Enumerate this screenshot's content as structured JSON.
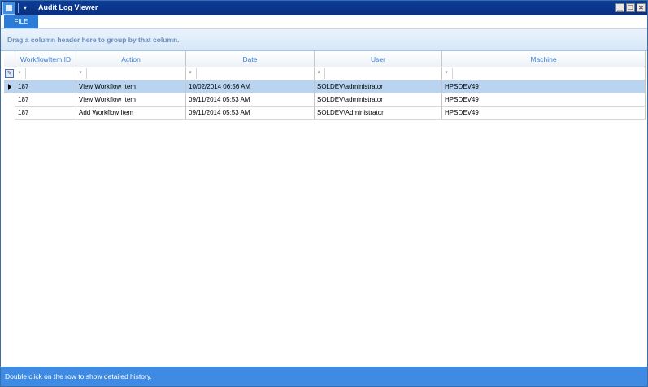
{
  "window": {
    "title": "Audit Log Viewer",
    "quick_access_glyph": "▾",
    "controls": {
      "minimize": "▁",
      "maximize": "☐",
      "close": "✕"
    }
  },
  "ribbon": {
    "file_tab": "FILE"
  },
  "grid": {
    "group_panel_text": "Drag a column header here to group by that column.",
    "columns": [
      "WorkflowItem ID",
      "Action",
      "Date",
      "User",
      "Machine"
    ],
    "filter_operator": "*",
    "rows": [
      [
        "187",
        "View Workflow Item",
        "10/02/2014 06:56 AM",
        "SOLDEV\\administrator",
        "HPSDEV49"
      ],
      [
        "187",
        "View Workflow Item",
        "09/11/2014 05:53 AM",
        "SOLDEV\\administrator",
        "HPSDEV49"
      ],
      [
        "187",
        "Add Workflow Item",
        "09/11/2014 05:53 AM",
        "SOLDEV\\Administrator",
        "HPSDEV49"
      ]
    ],
    "selected_row": 0
  },
  "status_bar": {
    "text": "Double click on the row to show detailed history."
  },
  "colors": {
    "title_bar": "#0b3c98",
    "accent": "#2b7bd8",
    "selection": "#b8d4f0",
    "status_bar": "#3f8ae2"
  },
  "icons": [
    "app-icon",
    "quick-access-dropdown-icon",
    "filter-editor-icon",
    "row-pointer-icon"
  ]
}
